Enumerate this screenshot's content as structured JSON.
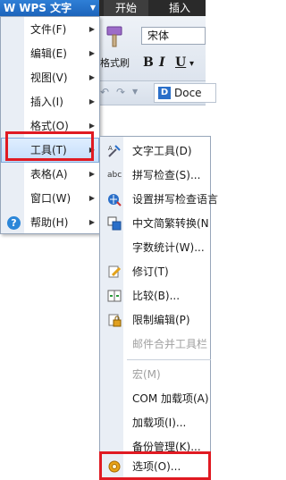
{
  "app": {
    "title": "WPS 文字",
    "logo_glyph": "W",
    "tabs": [
      "开始",
      "插入"
    ]
  },
  "ribbon": {
    "format_painter_label": "格式刷",
    "font_name": "宋体",
    "bold": "B",
    "italic": "I",
    "underline": "U",
    "more": "▾",
    "document_tab": "Doce",
    "document_icon": "D"
  },
  "menu": {
    "items": [
      {
        "label": "文件(F)",
        "arrow": true
      },
      {
        "label": "编辑(E)",
        "arrow": true
      },
      {
        "label": "视图(V)",
        "arrow": true
      },
      {
        "label": "插入(I)",
        "arrow": true
      },
      {
        "label": "格式(O)",
        "arrow": true
      },
      {
        "label": "工具(T)",
        "arrow": true,
        "active": true
      },
      {
        "label": "表格(A)",
        "arrow": true
      },
      {
        "label": "窗口(W)",
        "arrow": true
      },
      {
        "label": "帮助(H)",
        "arrow": true,
        "icon": "help-icon"
      }
    ],
    "help_glyph": "?"
  },
  "tools_submenu": {
    "items": [
      {
        "label": "文字工具(D)",
        "icon": "text-tools-icon"
      },
      {
        "label": "拼写检查(S)...",
        "icon": "spell-check-icon",
        "icon_text": "abc"
      },
      {
        "label": "设置拼写检查语言",
        "icon": "spell-language-icon"
      },
      {
        "label": "中文简繁转换(N",
        "icon": "chinese-convert-icon"
      },
      {
        "label": "字数统计(W)...",
        "icon": ""
      },
      {
        "label": "修订(T)",
        "icon": "track-changes-icon"
      },
      {
        "label": "比较(B)...",
        "icon": "compare-icon"
      },
      {
        "label": "限制编辑(P)",
        "icon": "restrict-edit-icon"
      },
      {
        "label": "邮件合并工具栏",
        "icon": "",
        "disabled": true
      },
      {
        "label": "宏(M)",
        "icon": "",
        "disabled": true
      },
      {
        "label": "COM 加载项(A)",
        "icon": ""
      },
      {
        "label": "加载项(I)...",
        "icon": ""
      },
      {
        "label": "备份管理(K)...",
        "icon": ""
      },
      {
        "label": "选项(O)...",
        "icon": "options-gear-icon"
      }
    ]
  },
  "colors": {
    "highlight": "#e01a22",
    "title_bar": "#1c64bb"
  }
}
